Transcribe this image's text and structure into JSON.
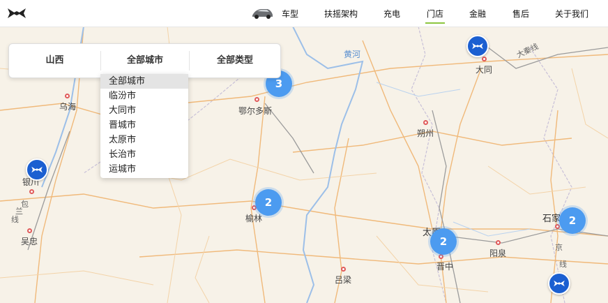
{
  "header": {
    "logo_icon": "xpeng-logo",
    "nav": [
      {
        "label": "车型",
        "active": false
      },
      {
        "label": "扶摇架构",
        "active": false
      },
      {
        "label": "充电",
        "active": false
      },
      {
        "label": "门店",
        "active": true
      },
      {
        "label": "金融",
        "active": false
      },
      {
        "label": "售后",
        "active": false
      },
      {
        "label": "关于我们",
        "active": false
      }
    ],
    "active_color": "#8cc63f"
  },
  "filters": {
    "province": "山西",
    "city": "全部城市",
    "type": "全部类型"
  },
  "city_dropdown": {
    "options": [
      "全部城市",
      "临汾市",
      "大同市",
      "晋城市",
      "太原市",
      "长治市",
      "运城市"
    ],
    "selected": "全部城市"
  },
  "map": {
    "cities": {
      "wuhai": "乌海",
      "eerduosi": "鄂尔多斯",
      "yinchuan": "银川",
      "wuzhong": "吴忠",
      "yulin": "榆林",
      "lvliang": "吕梁",
      "shuozhou": "朔州",
      "datong": "大同",
      "taiyuan": "太原",
      "jinzhong": "晋中",
      "yangquan": "阳泉",
      "shijiazhuang": "石家"
    },
    "labels": {
      "yellow_river": "黄河",
      "daqin_line": "大秦线",
      "baolan_line_1": "包",
      "baolan_line_2": "兰",
      "baolan_line_3": "线",
      "jingguang_1": "京",
      "jingguang_2": "线"
    },
    "clusters": {
      "eerduosi": "3",
      "yulin": "2",
      "taiyuan": "2",
      "shijiazhuang": "2"
    },
    "store_pin_icon": "xpeng-store-pin",
    "cluster_color": "#4c9bf0",
    "pin_color": "#1b5fd1"
  }
}
